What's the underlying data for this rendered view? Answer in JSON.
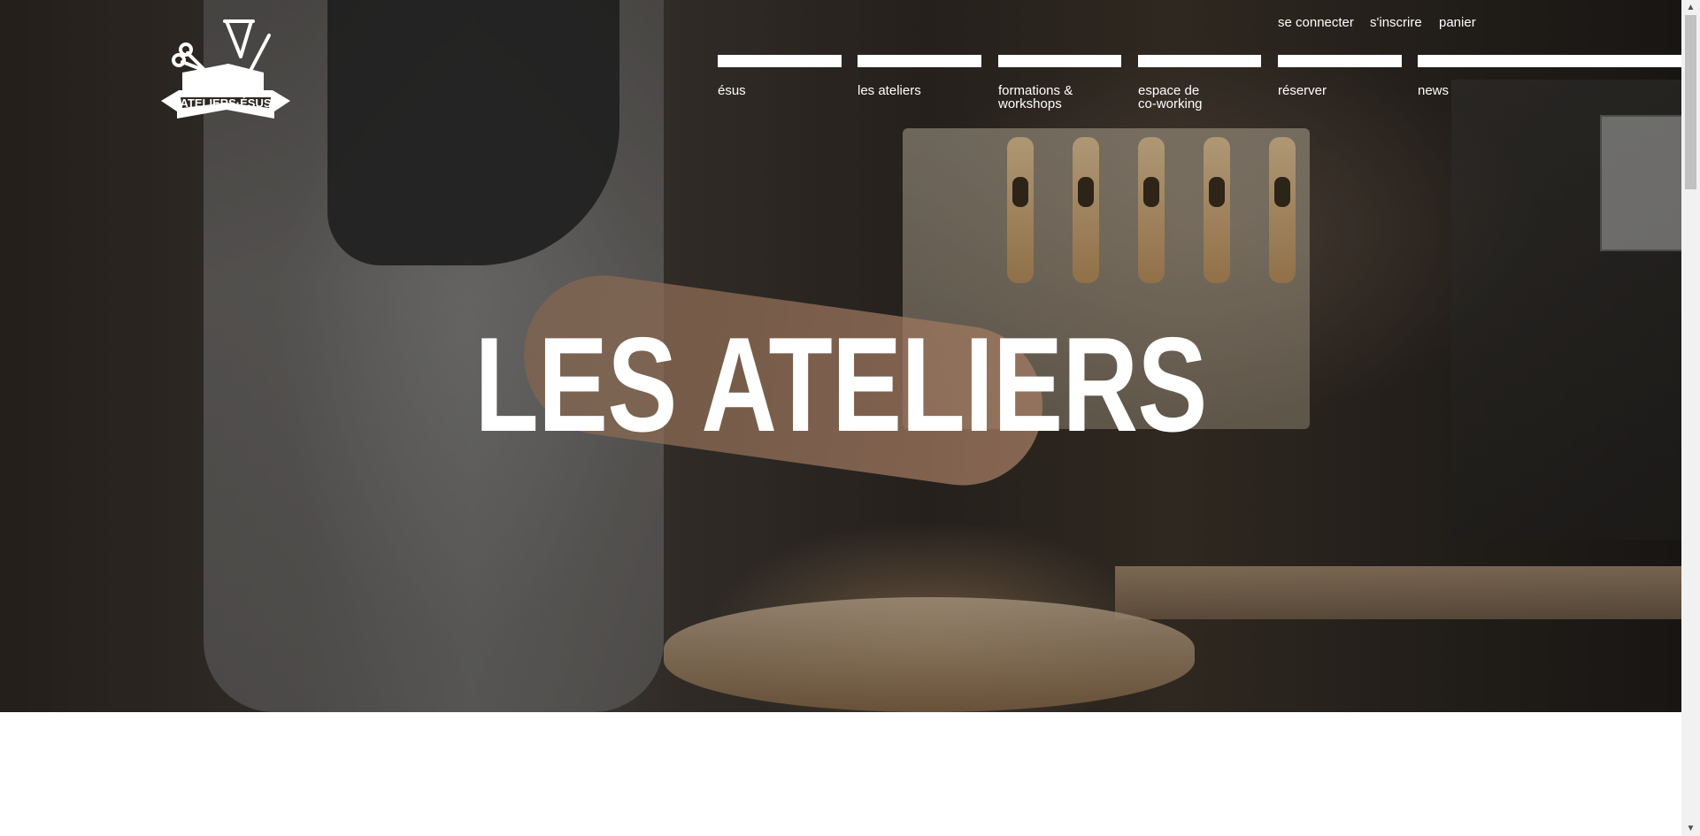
{
  "logo": {
    "text": "ATELIERS·ÉSUS",
    "icon": "toolbox-logo-icon"
  },
  "account_links": [
    {
      "label": "se connecter"
    },
    {
      "label": "s'inscrire"
    },
    {
      "label": "panier"
    }
  ],
  "nav": [
    {
      "label": "ésus"
    },
    {
      "label": "les ateliers"
    },
    {
      "label": "formations &\nworkshops"
    },
    {
      "label": "espace de\nco-working"
    },
    {
      "label": "réserver"
    },
    {
      "label": "news"
    }
  ],
  "hero": {
    "title": "LES ATELIERS"
  },
  "colors": {
    "nav_text": "#ffffff",
    "page_bg": "#ffffff"
  }
}
